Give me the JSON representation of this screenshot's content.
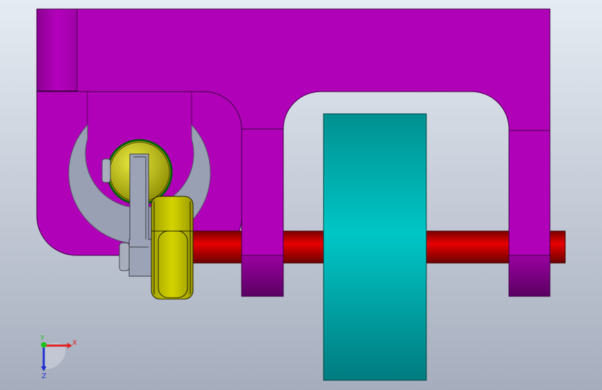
{
  "viewport": {
    "background_top": "#e6ecf3",
    "background_bottom": "#a6adbd"
  },
  "colors": {
    "frame": "#b000b8",
    "frame_edge": "#5a0060",
    "shaft": "#d80000",
    "wheel": "#00c4c4",
    "roller": "#cccc00",
    "linkage": "#9da3b6"
  },
  "triad": {
    "x_label": "X",
    "y_label": "Y",
    "z_label": "Z",
    "x_color": "#e02020",
    "y_color": "#20c020",
    "z_color": "#2030d0"
  }
}
